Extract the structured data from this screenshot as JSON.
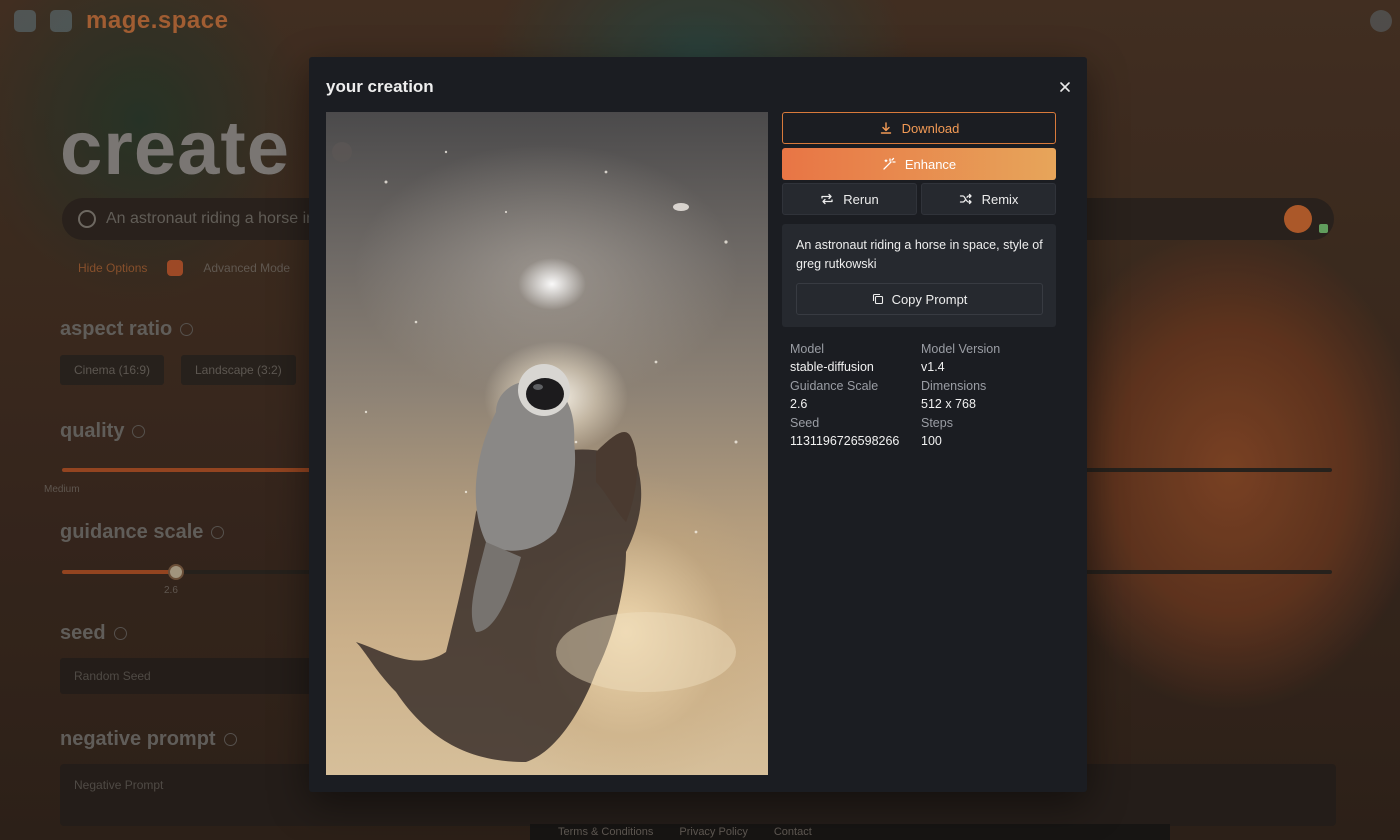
{
  "background": {
    "logo": "mage.space",
    "heading": "create",
    "search_placeholder": "An astronaut riding a horse in",
    "options": [
      "Hide Options",
      "Advanced Mode"
    ],
    "sections": [
      "aspect ratio",
      "quality",
      "guidance scale",
      "seed",
      "negative prompt"
    ],
    "aspect_chips": [
      "Cinema (16:9)",
      "Landscape (3:2)"
    ],
    "quality_label": "Medium",
    "guidance_value": "2.6",
    "seed_placeholder": "Random Seed",
    "negative_placeholder": "Negative Prompt",
    "footer_links": [
      "Terms & Conditions",
      "Privacy Policy",
      "Contact"
    ]
  },
  "modal": {
    "title": "your creation",
    "buttons": {
      "download": "Download",
      "enhance": "Enhance",
      "rerun": "Rerun",
      "remix": "Remix",
      "copy_prompt": "Copy Prompt"
    },
    "prompt": "An astronaut riding a horse in space, style of greg rutkowski",
    "details": [
      {
        "label": "Model",
        "value": "stable-diffusion"
      },
      {
        "label": "Model Version",
        "value": "v1.4"
      },
      {
        "label": "Guidance Scale",
        "value": "2.6"
      },
      {
        "label": "Dimensions",
        "value": "512 x 768"
      },
      {
        "label": "Seed",
        "value": "1131196726598266"
      },
      {
        "label": "Steps",
        "value": "100"
      }
    ]
  },
  "colors": {
    "accent": "#e87545",
    "accent_end": "#e7a55a",
    "modal_bg": "#1b1d22",
    "card_bg": "#26292f"
  },
  "icons": [
    "download-icon",
    "magic-wand-icon",
    "repeat-icon",
    "shuffle-icon",
    "copy-icon",
    "close-icon",
    "search-icon"
  ]
}
